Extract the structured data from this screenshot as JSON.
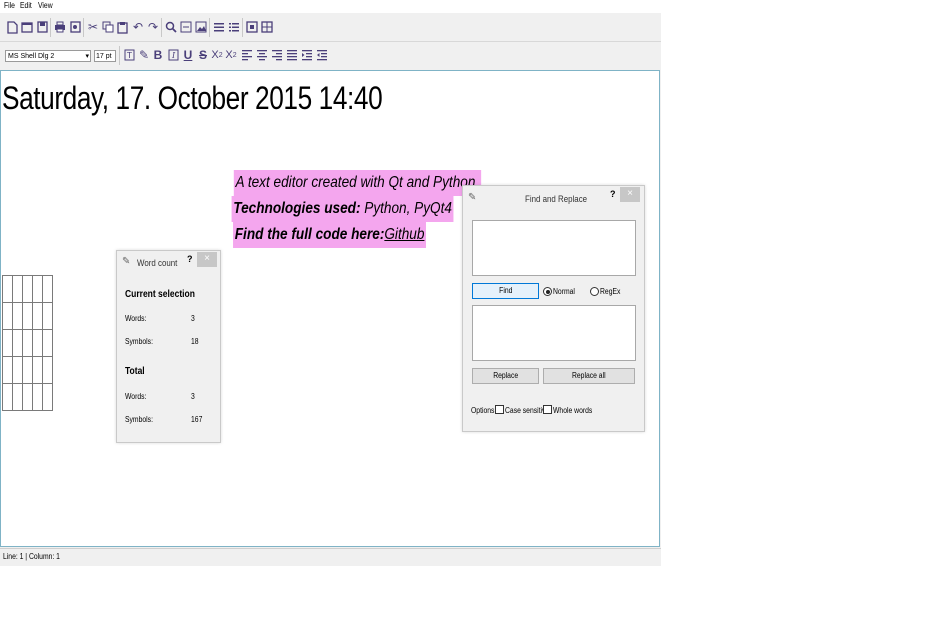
{
  "menu": {
    "file": "File",
    "edit": "Edit",
    "view": "View"
  },
  "format_bar": {
    "font_name": "MS Shell Dlg 2",
    "font_size": "17 pt"
  },
  "document": {
    "date_line": "Saturday, 17. October 2015 14:40",
    "banner_line1": "A text editor created with Qt and Python.",
    "banner_line2_bold": "Technologies used:",
    "banner_line2_rest": " Python, PyQt4",
    "banner_line3_bold": "Find the full code here:",
    "banner_line3_link": "Github",
    "highlight_color": "#f4a6ee"
  },
  "status_bar": {
    "text": "Line: 1 | Column: 1"
  },
  "word_count": {
    "title": "Word count",
    "help": "?",
    "close": "×",
    "current_heading": "Current selection",
    "words_label": "Words:",
    "words_value": "3",
    "symbols_label": "Symbols:",
    "symbols_value": "18",
    "total_heading": "Total",
    "total_words_label": "Words:",
    "total_words_value": "3",
    "total_symbols_label": "Symbols:",
    "total_symbols_value": "167"
  },
  "find_replace": {
    "title": "Find and Replace",
    "help": "?",
    "close": "×",
    "find_button": "Find",
    "normal_label": "Normal",
    "regex_label": "RegEx",
    "replace_button": "Replace",
    "replace_all_button": "Replace all",
    "options_label": "Options:",
    "case_sensitive_label": "Case sensitive",
    "whole_words_label": "Whole words"
  }
}
